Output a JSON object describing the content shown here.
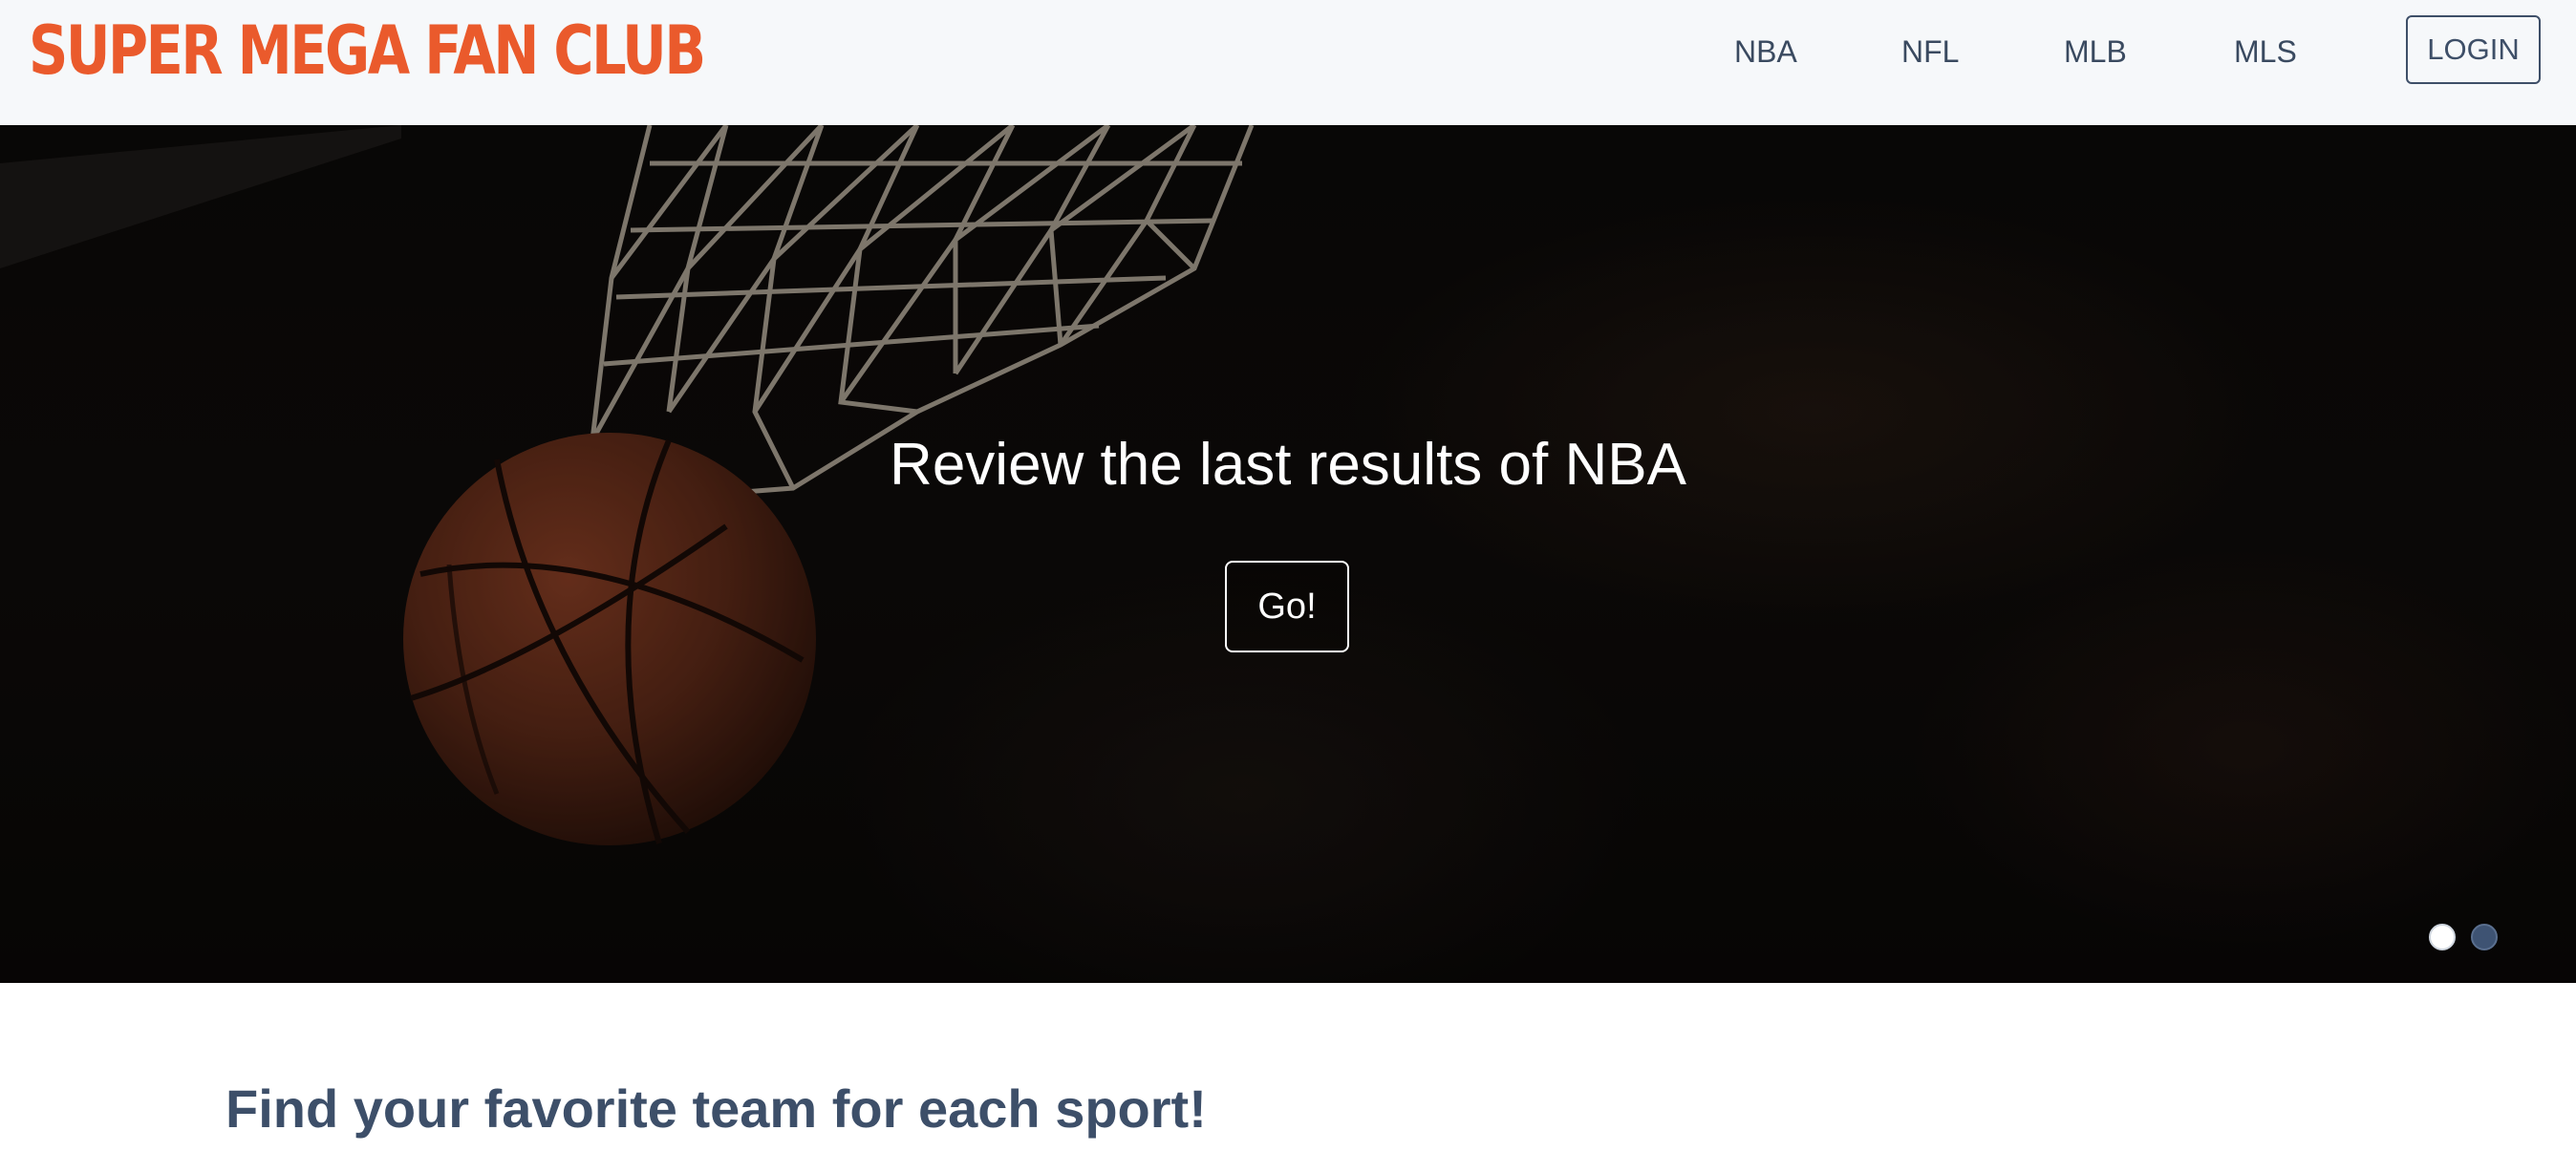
{
  "header": {
    "logo_text": "SUPER MEGA FAN CLUB",
    "nav": [
      {
        "label": "NBA"
      },
      {
        "label": "NFL"
      },
      {
        "label": "MLB"
      },
      {
        "label": "MLS"
      }
    ],
    "login_label": "LOGIN"
  },
  "hero": {
    "title": "Review the last results of NBA",
    "button_label": "Go!",
    "slides": {
      "count": 2,
      "active_index": 0
    }
  },
  "section": {
    "title": "Find your favorite team for each sport!"
  },
  "colors": {
    "brand": "#ea5a2c",
    "nav_text": "#3a4a60",
    "header_bg": "#f6f8fa",
    "hero_bg": "#0c0a09",
    "section_title": "#3d4f69",
    "dot_inactive": "#3e5373"
  },
  "icons": {
    "hero_decoration": [
      "basketball-net-icon",
      "basketball-icon"
    ]
  }
}
